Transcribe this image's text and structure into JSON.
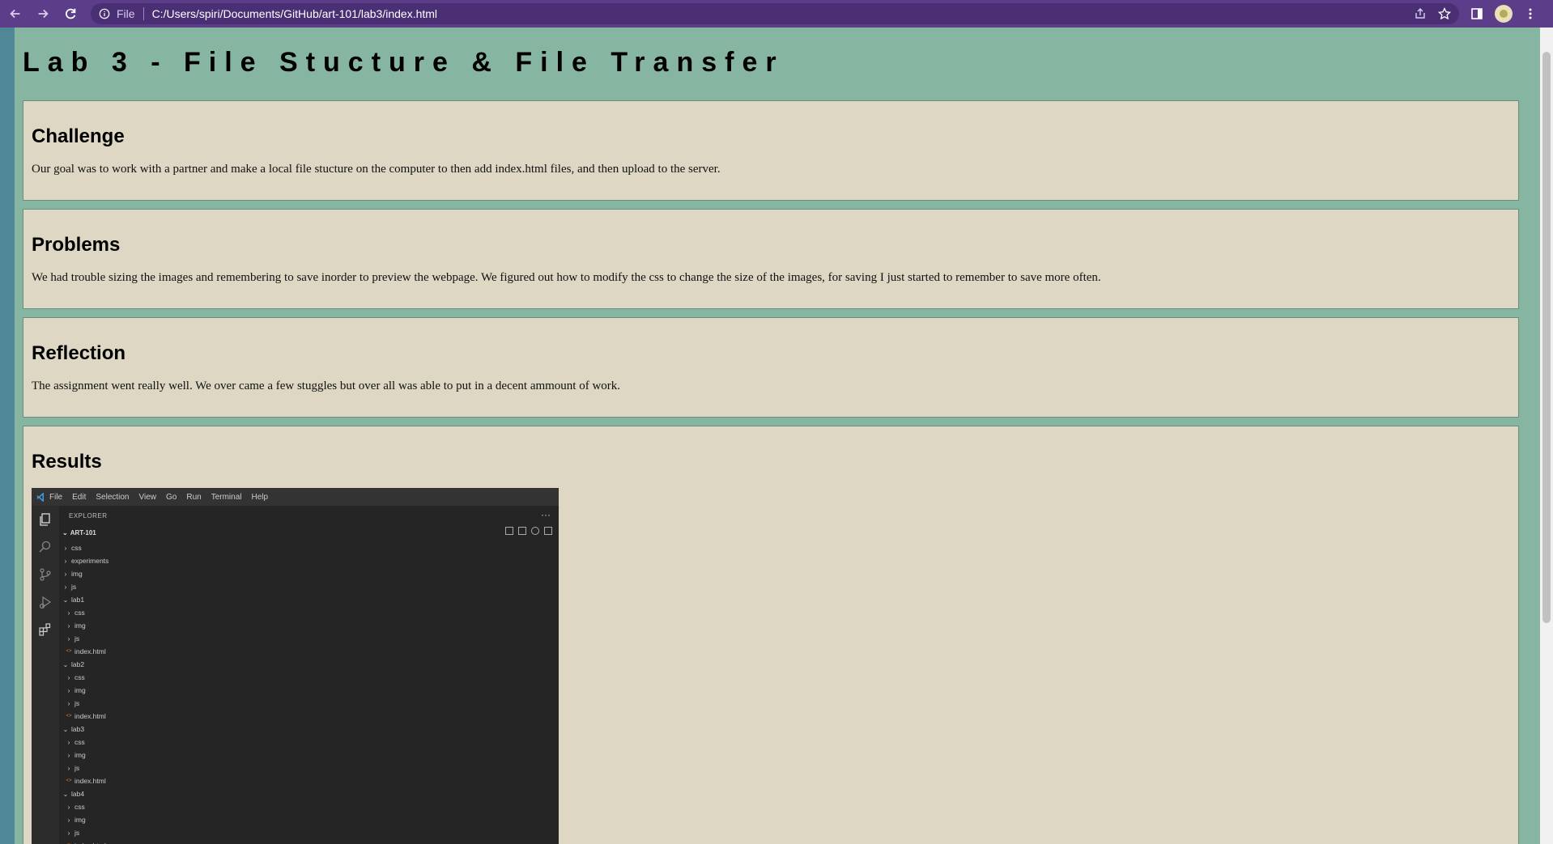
{
  "browser": {
    "scheme": "File",
    "url": "C:/Users/spiri/Documents/GitHub/art-101/lab3/index.html"
  },
  "page": {
    "title": "Lab 3 - File Stucture & File Transfer",
    "sections": [
      {
        "heading": "Challenge",
        "text": "Our goal was to work with a partner and make a local file stucture on the computer to then add index.html files, and then upload to the server."
      },
      {
        "heading": "Problems",
        "text": "We had trouble sizing the images and remembering to save inorder to preview the webpage. We figured out how to modify the css to change the size of the images, for saving I just started to remember to save more often."
      },
      {
        "heading": "Reflection",
        "text": "The assignment went really well. We over came a few stuggles but over all was able to put in a decent ammount of work."
      },
      {
        "heading": "Results",
        "text": ""
      }
    ]
  },
  "vscode": {
    "menu": [
      "File",
      "Edit",
      "Selection",
      "View",
      "Go",
      "Run",
      "Terminal",
      "Help"
    ],
    "explorer_label": "EXPLORER",
    "more": "···",
    "root": "ART-101",
    "tree": [
      {
        "label": "css",
        "level": 1,
        "kind": "folder-closed"
      },
      {
        "label": "experiments",
        "level": 1,
        "kind": "folder-closed"
      },
      {
        "label": "img",
        "level": 1,
        "kind": "folder-closed"
      },
      {
        "label": "js",
        "level": 1,
        "kind": "folder-closed"
      },
      {
        "label": "lab1",
        "level": 1,
        "kind": "folder-open"
      },
      {
        "label": "css",
        "level": 2,
        "kind": "folder-closed"
      },
      {
        "label": "img",
        "level": 2,
        "kind": "folder-closed"
      },
      {
        "label": "js",
        "level": 2,
        "kind": "folder-closed"
      },
      {
        "label": "index.html",
        "level": 2,
        "kind": "file-html"
      },
      {
        "label": "lab2",
        "level": 1,
        "kind": "folder-open"
      },
      {
        "label": "css",
        "level": 2,
        "kind": "folder-closed"
      },
      {
        "label": "img",
        "level": 2,
        "kind": "folder-closed"
      },
      {
        "label": "js",
        "level": 2,
        "kind": "folder-closed"
      },
      {
        "label": "index.html",
        "level": 2,
        "kind": "file-html"
      },
      {
        "label": "lab3",
        "level": 1,
        "kind": "folder-open"
      },
      {
        "label": "css",
        "level": 2,
        "kind": "folder-closed"
      },
      {
        "label": "img",
        "level": 2,
        "kind": "folder-closed"
      },
      {
        "label": "js",
        "level": 2,
        "kind": "folder-closed"
      },
      {
        "label": "index.html",
        "level": 2,
        "kind": "file-html"
      },
      {
        "label": "lab4",
        "level": 1,
        "kind": "folder-open"
      },
      {
        "label": "css",
        "level": 2,
        "kind": "folder-closed"
      },
      {
        "label": "img",
        "level": 2,
        "kind": "folder-closed"
      },
      {
        "label": "js",
        "level": 2,
        "kind": "folder-closed"
      },
      {
        "label": "index.html",
        "level": 2,
        "kind": "file-html"
      }
    ]
  }
}
